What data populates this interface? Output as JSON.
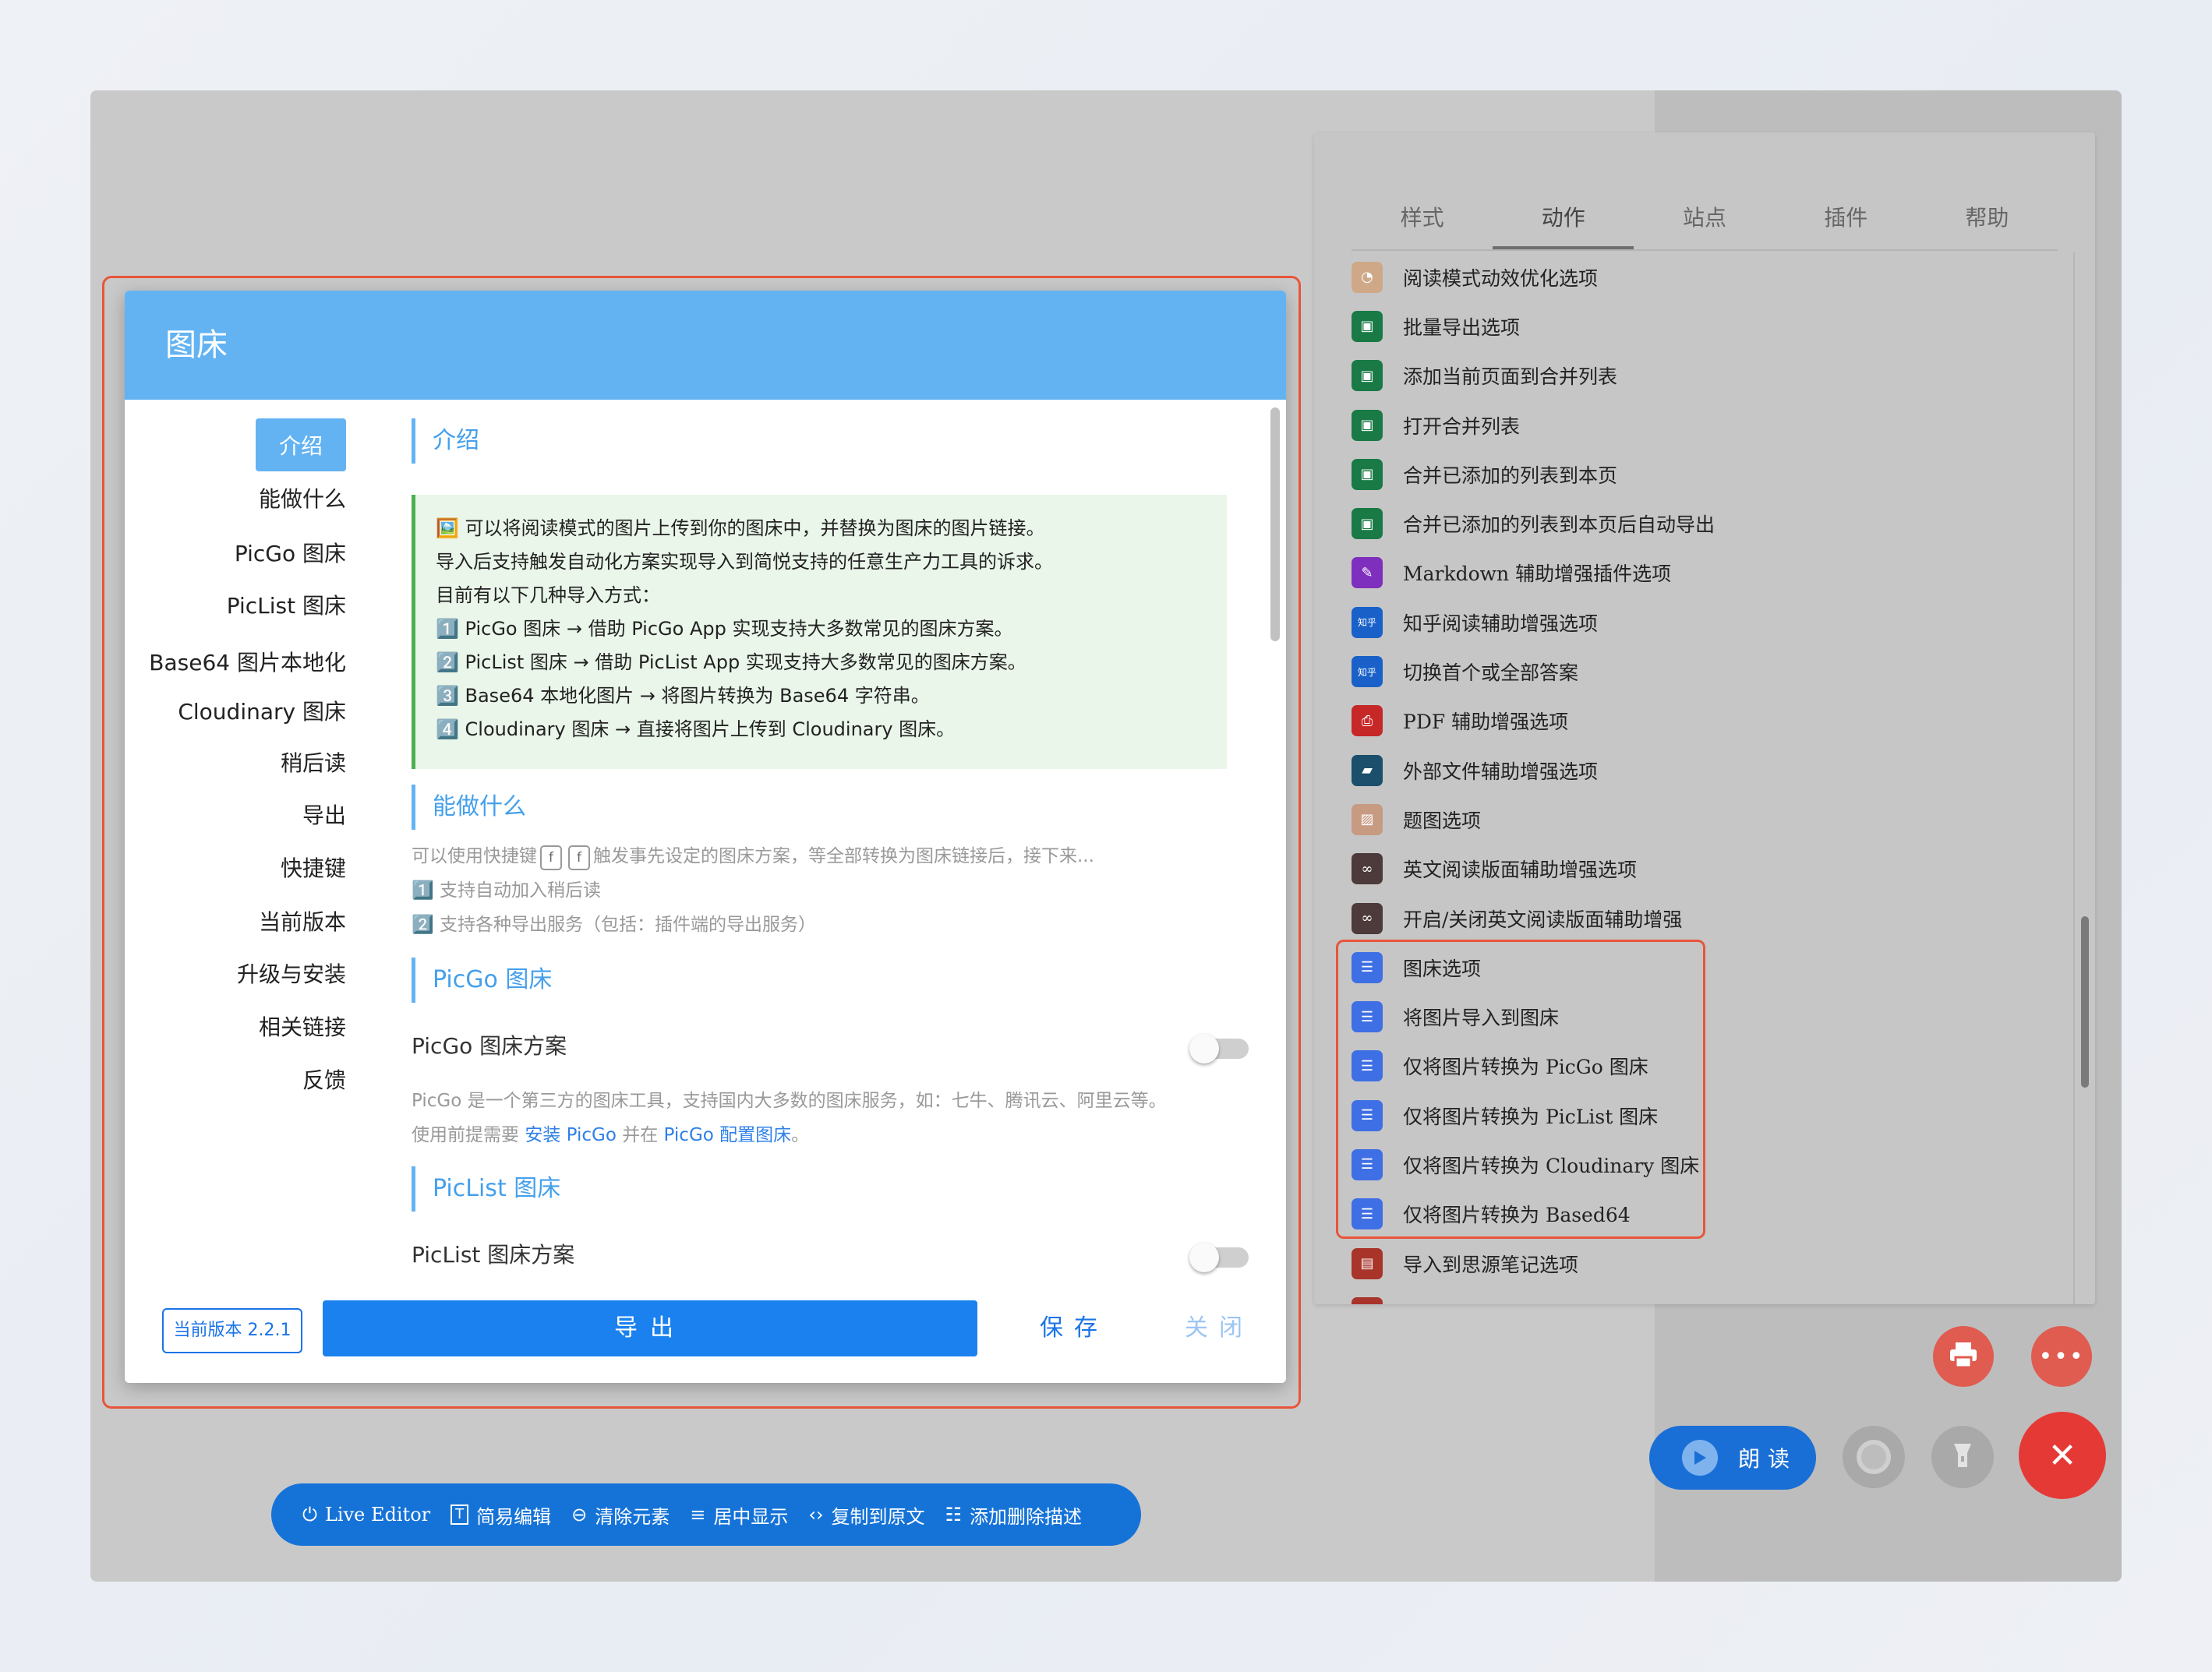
{
  "panel": {
    "tabs": [
      "样式",
      "动作",
      "站点",
      "插件",
      "帮助"
    ],
    "active_tab": 1,
    "actions": [
      {
        "label": "阅读模式动效优化选项",
        "icon": "gauge-icon",
        "color": "#cfa987"
      },
      {
        "label": "批量导出选项",
        "icon": "save-icon",
        "color": "#1a7a46"
      },
      {
        "label": "添加当前页面到合并列表",
        "icon": "save-icon",
        "color": "#1a7a46"
      },
      {
        "label": "打开合并列表",
        "icon": "save-icon",
        "color": "#1a7a46"
      },
      {
        "label": "合并已添加的列表到本页",
        "icon": "save-icon",
        "color": "#1a7a46"
      },
      {
        "label": "合并已添加的列表到本页后自动导出",
        "icon": "save-icon",
        "color": "#1a7a46"
      },
      {
        "label": "Markdown 辅助增强插件选项",
        "icon": "markdown-icon",
        "color": "#7e2fbe"
      },
      {
        "label": "知乎阅读辅助增强选项",
        "icon": "zhihu-icon",
        "color": "#1961c8"
      },
      {
        "label": "切换首个或全部答案",
        "icon": "zhihu-icon",
        "color": "#1961c8"
      },
      {
        "label": "PDF 辅助增强选项",
        "icon": "print-icon",
        "color": "#c62828"
      },
      {
        "label": "外部文件辅助增强选项",
        "icon": "folder-icon",
        "color": "#1b4f6b"
      },
      {
        "label": "题图选项",
        "icon": "image-icon",
        "color": "#c79a82"
      },
      {
        "label": "英文阅读版面辅助增强选项",
        "icon": "glasses-icon",
        "color": "#4d3a3a"
      },
      {
        "label": "开启/关闭英文阅读版面辅助增强",
        "icon": "glasses-icon",
        "color": "#4d3a3a"
      },
      {
        "label": "图床选项",
        "icon": "checklist-icon",
        "color": "#3f6fe4"
      },
      {
        "label": "将图片导入到图床",
        "icon": "checklist-icon",
        "color": "#3f6fe4"
      },
      {
        "label": "仅将图片转换为 PicGo 图床",
        "icon": "checklist-icon",
        "color": "#3f6fe4"
      },
      {
        "label": "仅将图片转换为 PicList 图床",
        "icon": "checklist-icon",
        "color": "#3f6fe4"
      },
      {
        "label": "仅将图片转换为 Cloudinary 图床",
        "icon": "checklist-icon",
        "color": "#3f6fe4"
      },
      {
        "label": "仅将图片转换为 Based64",
        "icon": "checklist-icon",
        "color": "#3f6fe4"
      },
      {
        "label": "导入到思源笔记选项",
        "icon": "note-icon",
        "color": "#a8342a"
      },
      {
        "label": "",
        "icon": "note-icon",
        "color": "#a8342a"
      }
    ]
  },
  "dialog": {
    "title": "图床",
    "nav": [
      "介绍",
      "能做什么",
      "PicGo 图床",
      "PicList 图床",
      "Base64 图片本地化",
      "Cloudinary 图床",
      "稍后读",
      "导出",
      "快捷键",
      "当前版本",
      "升级与安装",
      "相关链接",
      "反馈"
    ],
    "sections": {
      "intro_title": "介绍",
      "intro_lines": [
        "🖼️ 可以将阅读模式的图片上传到你的图床中，并替换为图床的图片链接。",
        "导入后支持触发自动化方案实现导入到简悦支持的任意生产力工具的诉求。",
        "目前有以下几种导入方式：",
        "1️⃣ PicGo 图床 → 借助 PicGo App 实现支持大多数常见的图床方案。",
        "2️⃣ PicList 图床 → 借助 PicList App 实现支持大多数常见的图床方案。",
        "3️⃣ Base64 本地化图片 → 将图片转换为 Base64 字符串。",
        "4️⃣ Cloudinary 图床 → 直接将图片上传到 Cloudinary 图床。"
      ],
      "what_title": "能做什么",
      "what_pre": "可以使用快捷键",
      "what_keys": [
        "f",
        "f"
      ],
      "what_post": "触发事先设定的图床方案，等全部转换为图床链接后，接下来...",
      "what_1": "1️⃣ 支持自动加入稍后读",
      "what_2": "2️⃣ 支持各种导出服务（包括：插件端的导出服务）",
      "picgo_title": "PicGo 图床",
      "picgo_option": "PicGo 图床方案",
      "picgo_desc": "PicGo 是一个第三方的图床工具，支持国内大多数的图床服务，如：七牛、腾讯云、阿里云等。",
      "picgo_use_pre": "使用前提需要",
      "picgo_link1": "安装 PicGo",
      "picgo_use_mid": "并在",
      "picgo_link2": "PicGo 配置图床",
      "picgo_use_post": "。",
      "piclist_title": "PicList 图床",
      "piclist_option": "PicList 图床方案"
    },
    "footer": {
      "version": "当前版本 2.2.1",
      "export": "导出",
      "save": "保存",
      "close": "关闭"
    }
  },
  "toolbar": [
    {
      "label": "Live Editor",
      "icon": "power-icon"
    },
    {
      "label": "简易编辑",
      "icon": "text-icon"
    },
    {
      "label": "清除元素",
      "icon": "minus-circle-icon"
    },
    {
      "label": "居中显示",
      "icon": "align-center-icon"
    },
    {
      "label": "复制到原文",
      "icon": "code-icon"
    },
    {
      "label": "添加删除描述",
      "icon": "list-icon"
    }
  ],
  "fabs": {
    "read_label": "朗读"
  },
  "colors": {
    "accent": "#63b3f3",
    "primary": "#1a81ee",
    "danger": "#e53935",
    "highlight": "#e8553a"
  }
}
